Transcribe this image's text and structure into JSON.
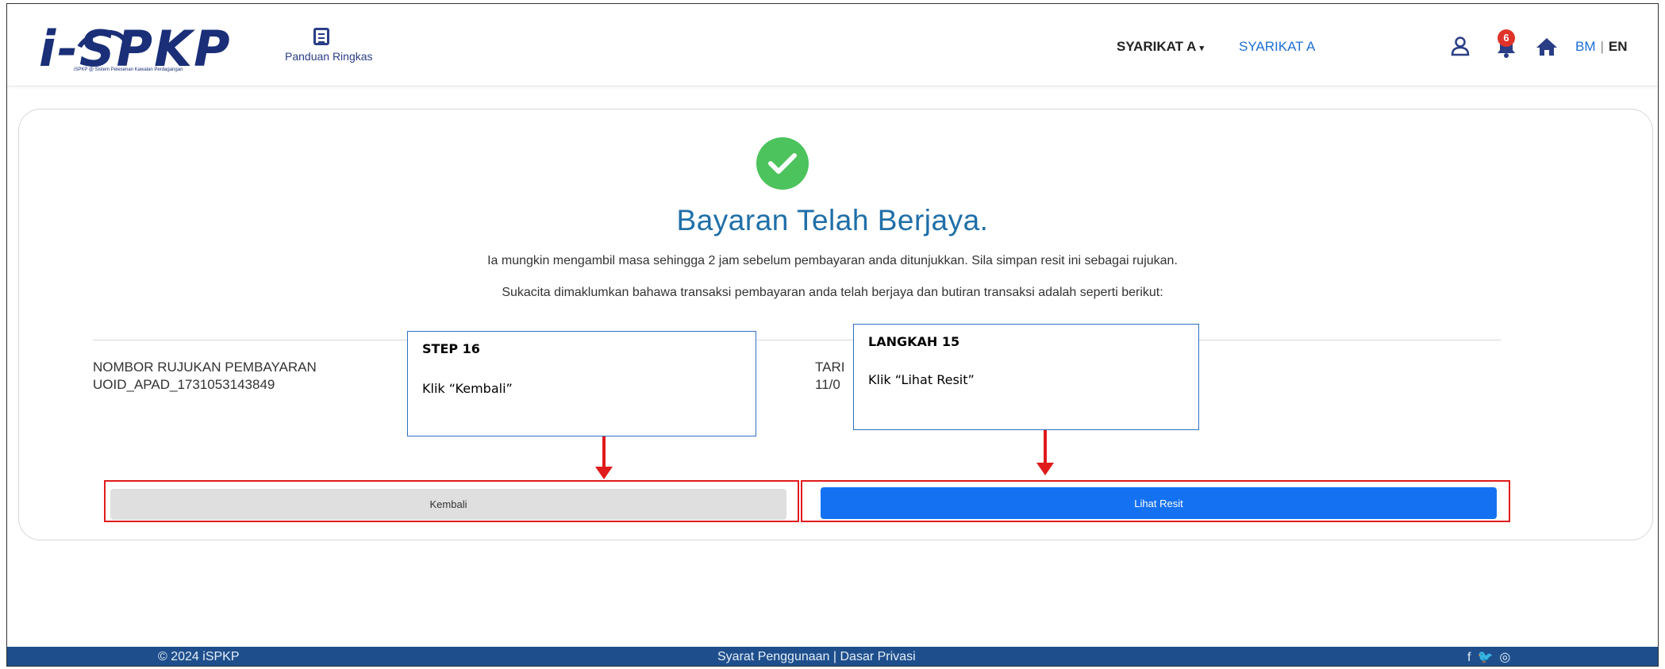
{
  "header": {
    "logo_text": "i-SPKP",
    "logo_tagline": "iSPKP @ Sistem Pelesenan Kawalan Perdagangan",
    "guide_label": "Panduan Ringkas",
    "company_dropdown": "SYARIKAT A",
    "company_name": "SYARIKAT A",
    "notification_count": "6",
    "lang_bm": "BM",
    "lang_sep": "|",
    "lang_en": "EN"
  },
  "main": {
    "title": "Bayaran Telah Berjaya.",
    "subtitle1": "Ia mungkin mengambil masa sehingga 2 jam sebelum pembayaran anda ditunjukkan. Sila simpan resit ini sebagai rujukan.",
    "subtitle2": "Sukacita dimaklumkan bahawa transaksi pembayaran anda telah berjaya dan butiran transaksi adalah seperti berikut:",
    "ref_label": "NOMBOR RUJUKAN PEMBAYARAN",
    "ref_value": "UOID_APAD_1731053143849",
    "date_label": "TARI",
    "date_value": "11/0",
    "back_button": "Kembali",
    "receipt_button": "Lihat Resit"
  },
  "callouts": {
    "step16_title": "STEP 16",
    "step16_text": "Klik “Kembali”",
    "step15_title": "LANGKAH 15",
    "step15_text": "Klik “Lihat Resit”"
  },
  "footer": {
    "copyright": "© 2024 iSPKP",
    "links": "Syarat Penggunaan | Dasar Privasi",
    "facebook": "f",
    "twitter": "🐦",
    "instagram": "◎"
  },
  "colors": {
    "primary": "#1471f2",
    "brand": "#1a2f78",
    "success": "#4cc35c",
    "highlight": "#e01b1b",
    "footer": "#1e4f8c"
  }
}
